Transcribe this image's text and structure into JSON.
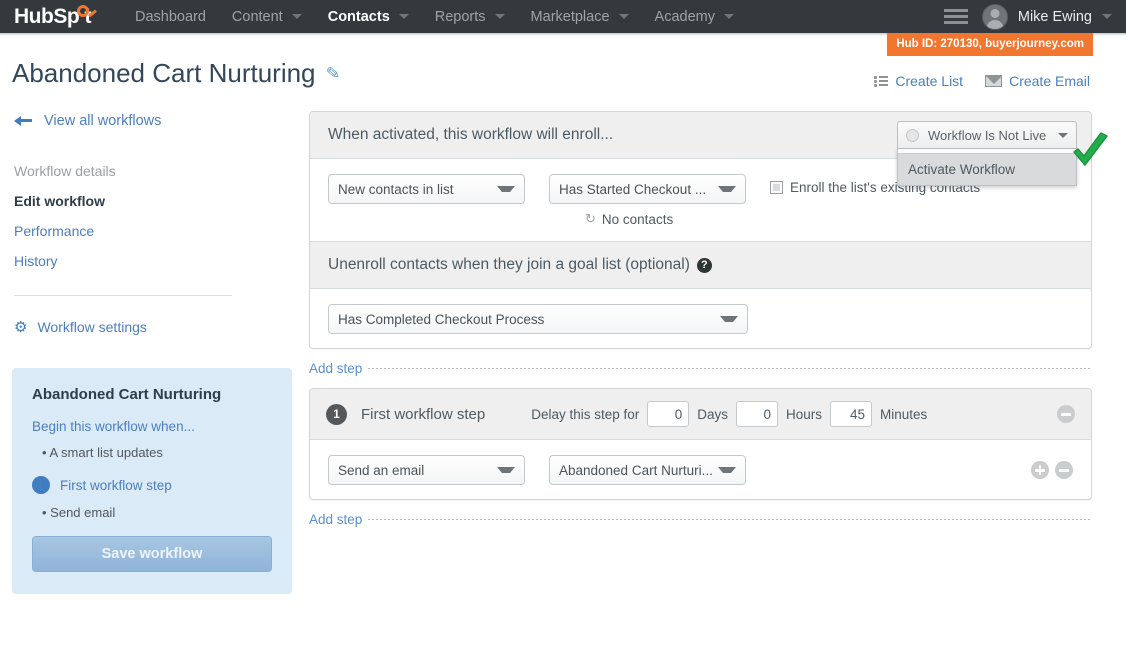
{
  "topnav": {
    "logo_text": "HubSp t",
    "items": [
      {
        "label": "Dashboard",
        "has_caret": false,
        "active": false
      },
      {
        "label": "Content",
        "has_caret": true,
        "active": false
      },
      {
        "label": "Contacts",
        "has_caret": true,
        "active": true
      },
      {
        "label": "Reports",
        "has_caret": true,
        "active": false
      },
      {
        "label": "Marketplace",
        "has_caret": true,
        "active": false
      },
      {
        "label": "Academy",
        "has_caret": true,
        "active": false
      }
    ],
    "username": "Mike Ewing",
    "hub_id": "Hub ID: 270130, buyerjourney.com"
  },
  "page": {
    "title": "Abandoned Cart Nurturing",
    "actions": [
      {
        "label": "Create List",
        "icon": "list-icon"
      },
      {
        "label": "Create Email",
        "icon": "mail-icon"
      }
    ]
  },
  "sidebar": {
    "back_label": "View all workflows",
    "section_label": "Workflow details",
    "links": [
      {
        "label": "Edit workflow",
        "current": true
      },
      {
        "label": "Performance",
        "current": false
      },
      {
        "label": "History",
        "current": false
      }
    ],
    "settings_label": "Workflow settings",
    "summary": {
      "title": "Abandoned Cart Nurturing",
      "begin_label": "Begin this workflow when...",
      "trigger_bullet": "• A smart list updates",
      "step_number": "1",
      "step_label": "First workflow step",
      "step_bullet": "• Send email",
      "save_label": "Save workflow"
    }
  },
  "enrollment": {
    "header": "When activated, this workflow will enroll...",
    "type_select": "New contacts in list",
    "list_select": "Has Started Checkout ...",
    "contacts_count": "No contacts",
    "existing_checkbox_label": "Enroll the list's existing contacts",
    "status": {
      "current": "Workflow Is Not Live",
      "menu_items": [
        "Activate Workflow"
      ]
    }
  },
  "goal": {
    "header": "Unenroll contacts when they join a goal list (optional)",
    "help_glyph": "?",
    "goal_select": "Has Completed Checkout Process"
  },
  "add_step_label": "Add step",
  "step": {
    "number": "1",
    "title": "First workflow step",
    "delay_label": "Delay this step for",
    "delay_days": "0",
    "days_unit": "Days",
    "delay_hours": "0",
    "hours_unit": "Hours",
    "delay_minutes": "45",
    "minutes_unit": "Minutes",
    "action_select": "Send an email",
    "email_select": "Abandoned Cart Nurturi..."
  },
  "colors": {
    "brand_orange": "#f2762e",
    "link_blue": "#4a7fc1",
    "nav_dark": "#33393d",
    "panel_gray": "#efefef",
    "summary_blue": "#dbeaf7",
    "annotation_green": "#22ac4b"
  }
}
